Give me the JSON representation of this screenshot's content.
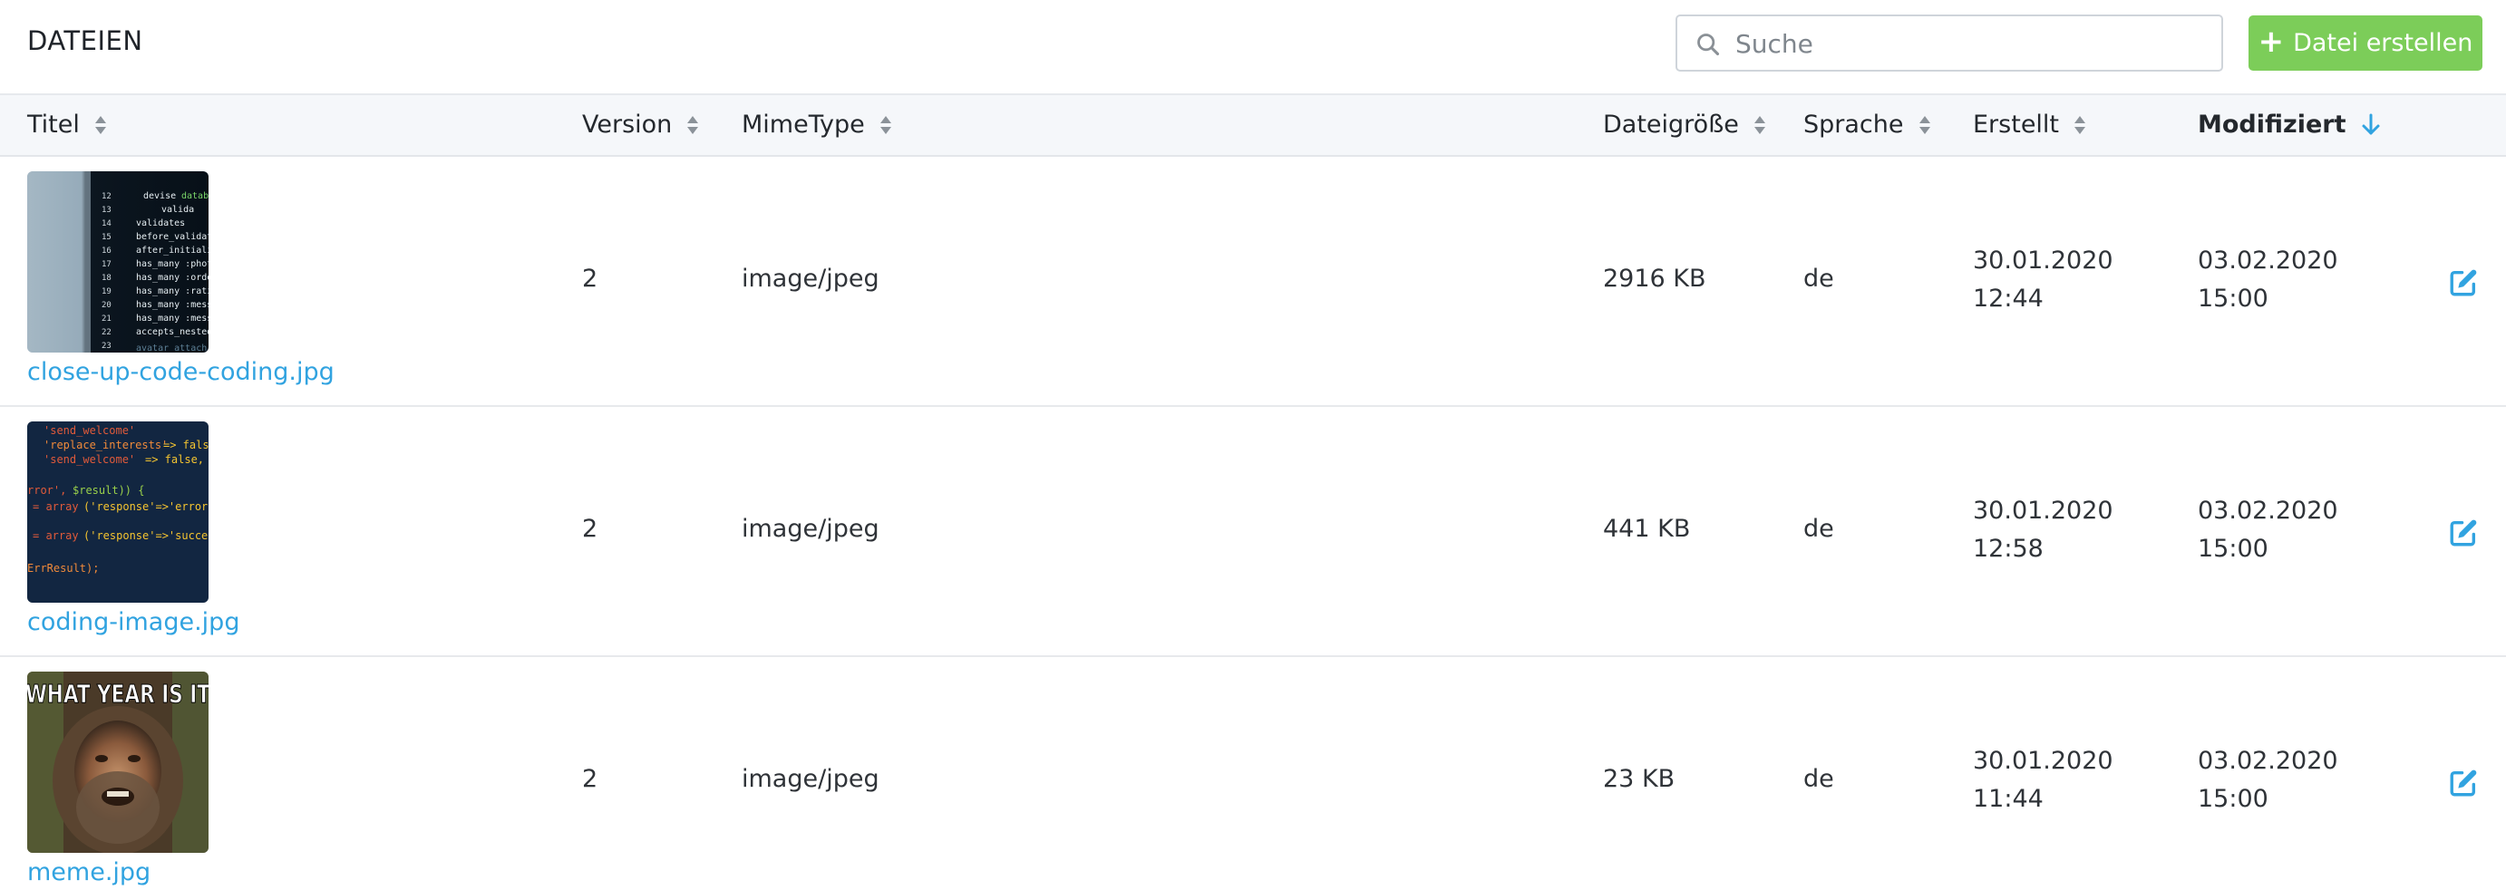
{
  "page": {
    "title": "DATEIEN"
  },
  "search": {
    "placeholder": "Suche",
    "icon": "search-icon"
  },
  "toolbar": {
    "create_label": "Datei erstellen",
    "create_color": "#7ccd59"
  },
  "table": {
    "columns": [
      {
        "label": "Titel",
        "sort": "none"
      },
      {
        "label": "Version",
        "sort": "none"
      },
      {
        "label": "MimeType",
        "sort": "none"
      },
      {
        "label": "Dateigröße",
        "sort": "none"
      },
      {
        "label": "Sprache",
        "sort": "none"
      },
      {
        "label": "Erstellt",
        "sort": "none"
      },
      {
        "label": "Modifiziert",
        "sort": "descending"
      }
    ],
    "rows": [
      {
        "title": "close-up-code-coding.jpg",
        "thumbnail": "code-close-up-thumbnail",
        "version": "2",
        "mime": "image/jpeg",
        "size": "2916 KB",
        "language": "de",
        "created_date": "30.01.2020",
        "created_time": "12:44",
        "modified_date": "03.02.2020",
        "modified_time": "15:00"
      },
      {
        "title": "coding-image.jpg",
        "thumbnail": "colorful-code-thumbnail",
        "version": "2",
        "mime": "image/jpeg",
        "size": "441 KB",
        "language": "de",
        "created_date": "30.01.2020",
        "created_time": "12:58",
        "modified_date": "03.02.2020",
        "modified_time": "15:00"
      },
      {
        "title": "meme.jpg",
        "thumbnail": "meme-thumbnail",
        "thumbnail_text": "WHAT YEAR IS IT",
        "version": "2",
        "mime": "image/jpeg",
        "size": "23 KB",
        "language": "de",
        "created_date": "30.01.2020",
        "created_time": "11:44",
        "modified_date": "03.02.2020",
        "modified_time": "15:00"
      }
    ]
  },
  "colors": {
    "link": "#31a3e0",
    "accent": "#31a3e0",
    "header_bg": "#f5f7fa"
  }
}
